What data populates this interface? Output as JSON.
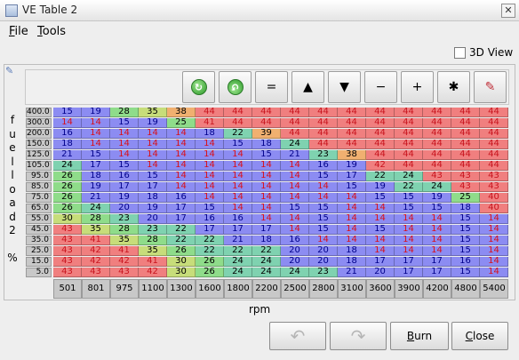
{
  "window": {
    "title": "VE Table 2",
    "close_glyph": "✕"
  },
  "menu": {
    "file": {
      "mnemonic": "F",
      "rest": "ile"
    },
    "tools": {
      "mnemonic": "T",
      "rest": "ools"
    }
  },
  "view3d": {
    "label": "3D View",
    "checked": false
  },
  "toolbar": {
    "buttons": [
      {
        "name": "increment-icon",
        "glyph": "↻"
      },
      {
        "name": "decrement-icon",
        "glyph": "↻"
      },
      {
        "name": "set-equal",
        "glyph": "="
      },
      {
        "name": "increase",
        "glyph": "▲"
      },
      {
        "name": "decrease",
        "glyph": "▼"
      },
      {
        "name": "subtract",
        "glyph": "−"
      },
      {
        "name": "add",
        "glyph": "+"
      },
      {
        "name": "multiply",
        "glyph": "✱"
      },
      {
        "name": "interpolate",
        "glyph": "✎"
      }
    ]
  },
  "table": {
    "y_axis_label": [
      "f",
      "u",
      "e",
      "l",
      "l",
      "o",
      "a",
      "d",
      "2",
      "",
      "%"
    ],
    "y_axis": [
      "400.0",
      "300.0",
      "200.0",
      "150.0",
      "125.0",
      "105.0",
      "95.0",
      "85.0",
      "75.0",
      "65.0",
      "55.0",
      "45.0",
      "35.0",
      "25.0",
      "15.0",
      "5.0"
    ],
    "x_axis": [
      "501",
      "801",
      "975",
      "1100",
      "1300",
      "1600",
      "1800",
      "2200",
      "2500",
      "2800",
      "3100",
      "3600",
      "3900",
      "4200",
      "4800",
      "5400"
    ],
    "x_axis_label": "rpm",
    "rows": [
      [
        15,
        19,
        28,
        35,
        38,
        44,
        44,
        44,
        44,
        44,
        44,
        44,
        44,
        44,
        44,
        44
      ],
      [
        14,
        14,
        15,
        19,
        25,
        41,
        44,
        44,
        44,
        44,
        44,
        44,
        44,
        44,
        44,
        44
      ],
      [
        16,
        14,
        14,
        14,
        14,
        18,
        22,
        39,
        44,
        44,
        44,
        44,
        44,
        44,
        44,
        44
      ],
      [
        18,
        14,
        14,
        14,
        14,
        14,
        15,
        18,
        24,
        44,
        44,
        44,
        44,
        44,
        44,
        44
      ],
      [
        21,
        15,
        14,
        14,
        14,
        14,
        14,
        15,
        21,
        23,
        38,
        44,
        44,
        44,
        44,
        44
      ],
      [
        24,
        17,
        15,
        14,
        14,
        14,
        14,
        14,
        14,
        16,
        19,
        42,
        44,
        44,
        44,
        44
      ],
      [
        26,
        18,
        16,
        15,
        14,
        14,
        14,
        14,
        14,
        15,
        17,
        22,
        24,
        43,
        43,
        43
      ],
      [
        26,
        19,
        17,
        17,
        14,
        14,
        14,
        14,
        14,
        14,
        15,
        19,
        22,
        24,
        43,
        43
      ],
      [
        26,
        21,
        19,
        18,
        16,
        14,
        14,
        14,
        14,
        14,
        14,
        15,
        15,
        19,
        25,
        40
      ],
      [
        26,
        24,
        20,
        19,
        17,
        15,
        14,
        14,
        15,
        15,
        14,
        14,
        15,
        15,
        18,
        40
      ],
      [
        30,
        28,
        23,
        20,
        17,
        16,
        16,
        14,
        14,
        15,
        14,
        14,
        14,
        14,
        15,
        14
      ],
      [
        43,
        35,
        28,
        23,
        22,
        17,
        17,
        17,
        14,
        15,
        14,
        15,
        14,
        14,
        15,
        14
      ],
      [
        43,
        41,
        35,
        28,
        22,
        22,
        21,
        18,
        16,
        14,
        14,
        14,
        14,
        14,
        15,
        14
      ],
      [
        43,
        42,
        41,
        35,
        26,
        22,
        22,
        22,
        20,
        20,
        18,
        14,
        14,
        14,
        15,
        14
      ],
      [
        43,
        42,
        42,
        41,
        30,
        26,
        24,
        24,
        20,
        20,
        18,
        17,
        17,
        17,
        16,
        14
      ],
      [
        43,
        43,
        43,
        42,
        30,
        26,
        24,
        24,
        24,
        23,
        21,
        20,
        17,
        17,
        15,
        14
      ]
    ]
  },
  "buttons": {
    "undo_glyph": "↶",
    "redo_glyph": "↷",
    "burn": {
      "mnemonic": "B",
      "rest": "urn"
    },
    "close": {
      "mnemonic": "C",
      "rest": "lose"
    }
  }
}
